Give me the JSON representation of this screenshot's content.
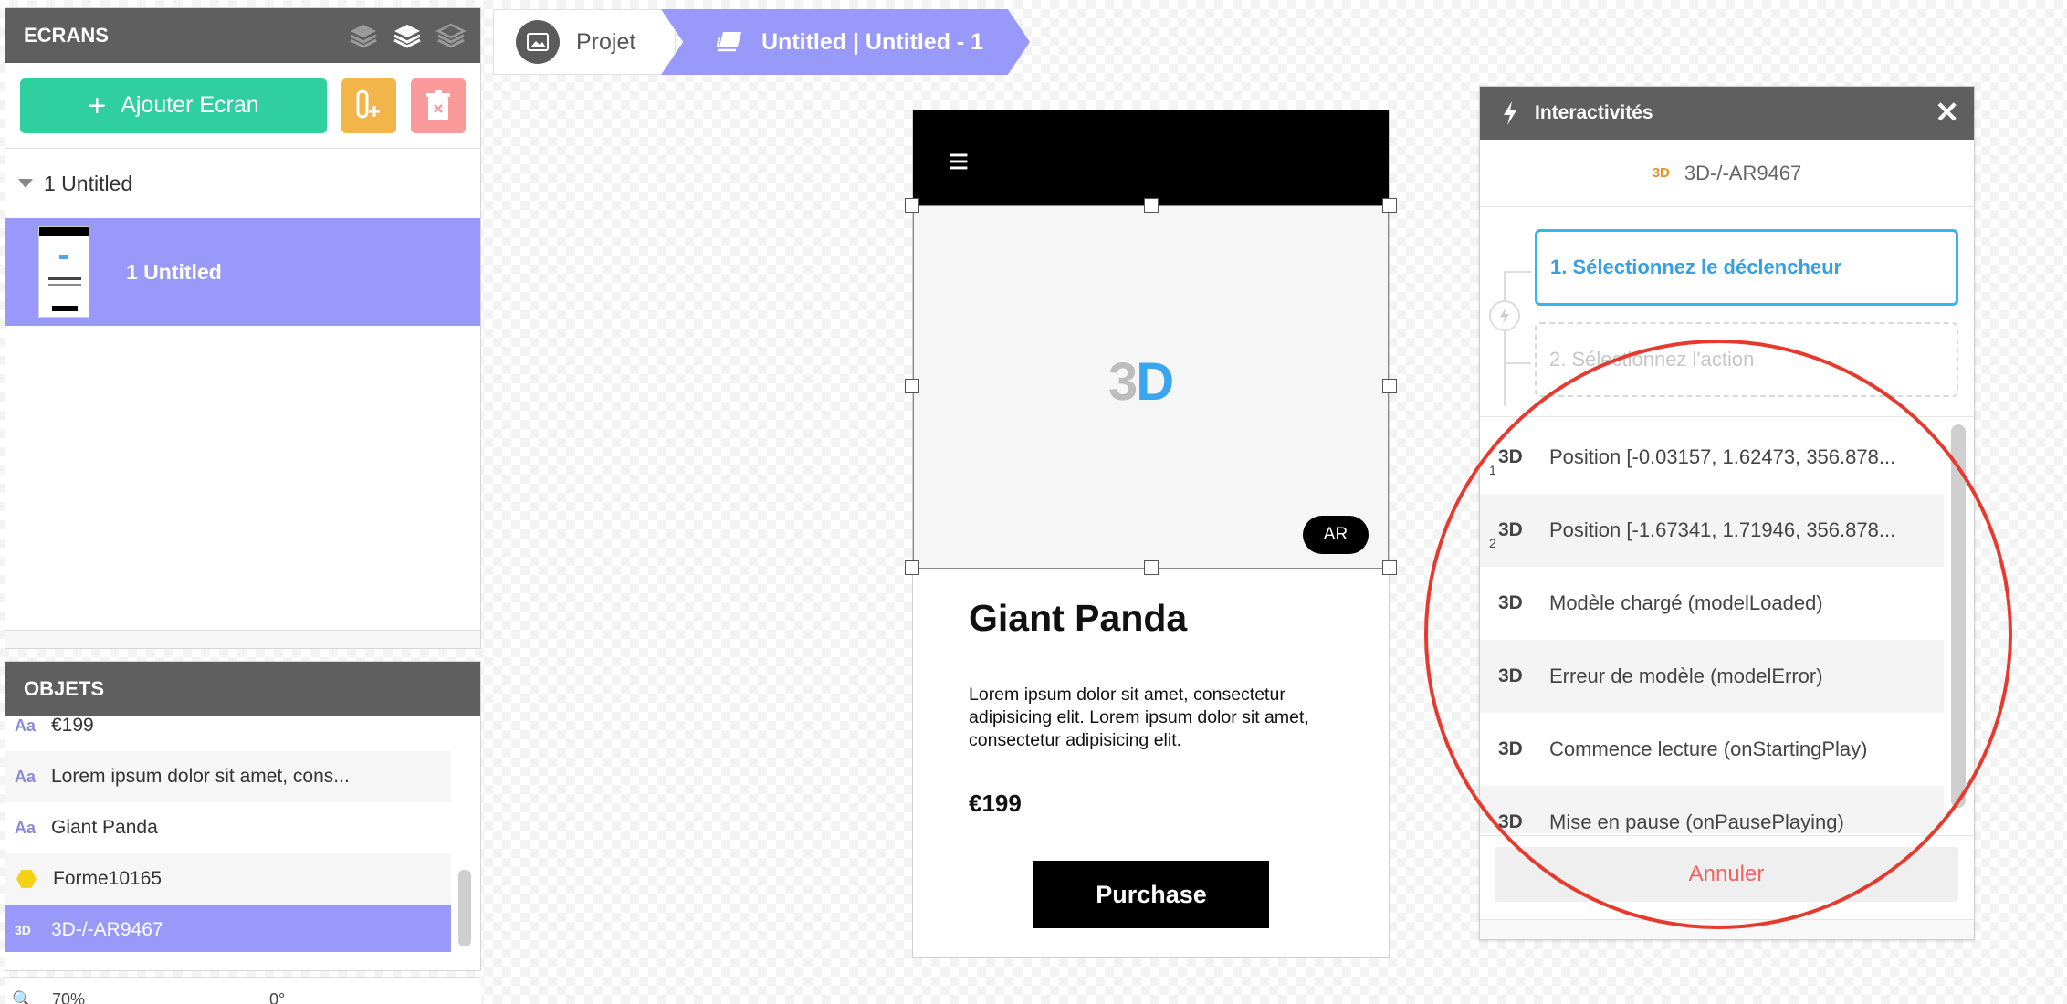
{
  "screens_panel": {
    "title": "ECRANS",
    "add_label": "Ajouter Ecran",
    "group_label": "1 Untitled",
    "screen_label": "1 Untitled"
  },
  "objects_panel": {
    "title": "OBJETS",
    "items": [
      {
        "icon": "text-icon",
        "label": "€199"
      },
      {
        "icon": "text-icon",
        "label": "Lorem ipsum dolor sit amet, cons..."
      },
      {
        "icon": "text-icon",
        "label": "Giant Panda"
      },
      {
        "icon": "shape-icon",
        "label": "Forme10165"
      },
      {
        "icon": "3d-icon",
        "label": "3D-/-AR9467",
        "selected": true
      }
    ]
  },
  "bottom_bar": {
    "zoom": "70%",
    "rotation": "0°"
  },
  "breadcrumb": {
    "project": "Projet",
    "current": "Untitled | Untitled - 1"
  },
  "artboard": {
    "hamburger": "≡",
    "logo": "3D",
    "ar": "AR",
    "title": "Giant Panda",
    "description": "Lorem ipsum dolor sit amet, consectetur adipisicing elit. Lorem ipsum dolor sit amet, consectetur adipisicing elit.",
    "price": "€199",
    "purchase": "Purchase"
  },
  "interactions": {
    "title": "Interactivités",
    "target_tag": "3D",
    "target": "3D-/-AR9467",
    "step1": "1. Sélectionnez le déclencheur",
    "step2": "2. Sélectionnez l'action",
    "triggers": [
      {
        "icon": "3D",
        "index": "1",
        "label": "Position [-0.03157, 1.62473, 356.878..."
      },
      {
        "icon": "3D",
        "index": "2",
        "label": "Position [-1.67341, 1.71946, 356.878..."
      },
      {
        "icon": "3D",
        "index": "",
        "label": "Modèle chargé (modelLoaded)"
      },
      {
        "icon": "3D",
        "index": "",
        "label": "Erreur de modèle (modelError)"
      },
      {
        "icon": "3D",
        "index": "",
        "label": "Commence lecture (onStartingPlay)"
      },
      {
        "icon": "3D",
        "index": "",
        "label": "Mise en pause (onPausePlaying)"
      }
    ],
    "cancel": "Annuler"
  },
  "colors": {
    "accent": "#9999fa",
    "green": "#2fcfa0",
    "orange": "#f2b549",
    "red_light": "#fb9a9a",
    "annotation": "#e63a2e"
  }
}
